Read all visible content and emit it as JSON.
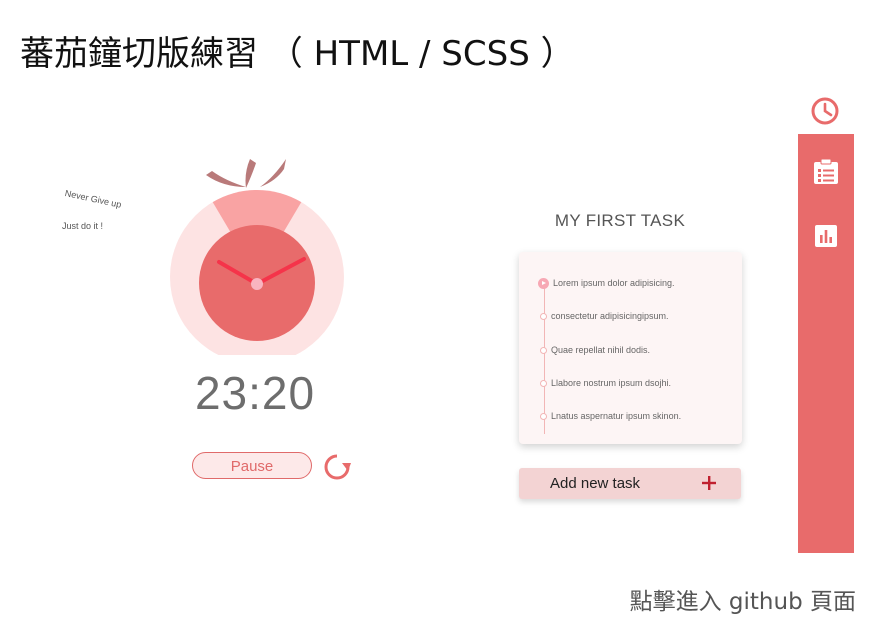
{
  "page": {
    "title": "蕃茄鐘切版練習 （ HTML / SCSS ）",
    "github_link": "點擊進入 github 頁面"
  },
  "mottos": {
    "line1": "Never Give up",
    "line2": "Just do it !"
  },
  "timer": {
    "time": "23:20",
    "pause_label": "Pause",
    "progress_fraction": 0.17
  },
  "tasks": {
    "heading": "MY FIRST TASK",
    "items": [
      {
        "label": "Lorem ipsum dolor adipisicing.",
        "active": true
      },
      {
        "label": "consectetur adipisicingipsum.",
        "active": false
      },
      {
        "label": "Quae repellat nihil dodis.",
        "active": false
      },
      {
        "label": "Llabore nostrum ipsum dsojhi.",
        "active": false
      },
      {
        "label": "Lnatus aspernatur ipsum skinon.",
        "active": false
      }
    ],
    "add_label": "Add new task"
  },
  "sidebar": {
    "icons": [
      "clock-icon",
      "clipboard-list-icon",
      "bar-chart-icon"
    ]
  },
  "colors": {
    "accent": "#e86b6b",
    "tomato_face": "#e86b6b",
    "tomato_ring": "#fde3e3",
    "tomato_progress": "#f9a3a3",
    "hand": "#f5344a",
    "stem": "#b97a7a"
  }
}
